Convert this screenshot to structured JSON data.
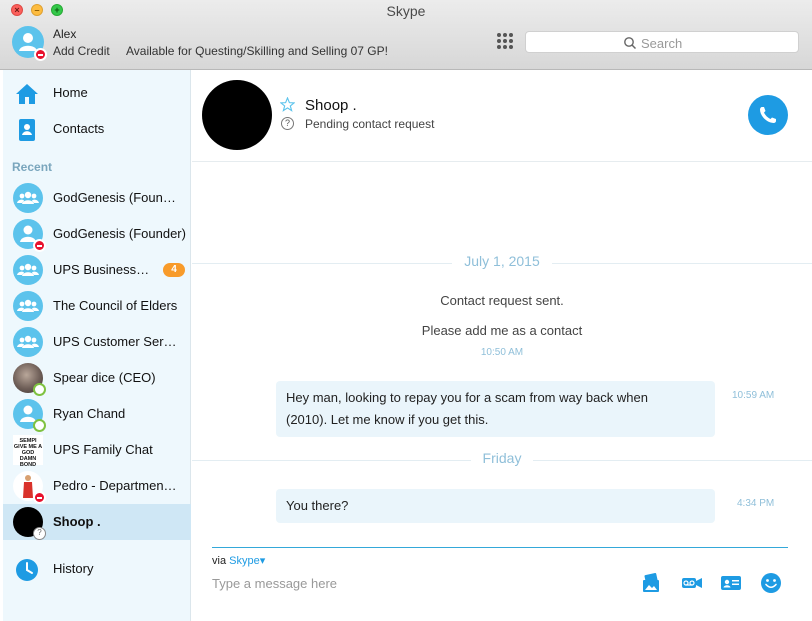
{
  "window": {
    "title": "Skype",
    "traffic": {
      "close": "×",
      "minimize": "–",
      "maximize": "+"
    }
  },
  "profile": {
    "name": "Alex",
    "credit_label": "Add Credit",
    "mood": "Available for Questing/Skilling and Selling 07 GP!"
  },
  "search": {
    "placeholder": "Search"
  },
  "sidebar": {
    "nav": [
      {
        "label": "Home",
        "icon": "home-icon"
      },
      {
        "label": "Contacts",
        "icon": "contacts-icon"
      }
    ],
    "recent_label": "Recent",
    "contacts": [
      {
        "name": "GodGenesis (Foun…",
        "avatar": "group"
      },
      {
        "name": "GodGenesis (Founder)",
        "avatar": "person",
        "status": "dnd"
      },
      {
        "name": "UPS Business…",
        "avatar": "group",
        "badge": "4"
      },
      {
        "name": "The Council of Elders",
        "avatar": "group"
      },
      {
        "name": "UPS Customer Ser…",
        "avatar": "group"
      },
      {
        "name": "Spear dice (CEO)",
        "avatar": "photo",
        "status": "online"
      },
      {
        "name": "Ryan Chand",
        "avatar": "person",
        "status": "online"
      },
      {
        "name": "UPS Family Chat",
        "avatar": "text",
        "avatar_text": "SEMPI GIVE ME A GOD DAMN BOND"
      },
      {
        "name": "Pedro - Departmen…",
        "avatar": "photo2",
        "status": "dnd"
      },
      {
        "name": "Shoop .",
        "avatar": "black",
        "status": "pending",
        "selected": true
      }
    ],
    "history_label": "History"
  },
  "conversation": {
    "name": "Shoop .",
    "status": "Pending contact request",
    "status_icon_text": "?",
    "separators": [
      "July 1, 2015",
      "Friday"
    ],
    "system_messages": [
      "Contact request sent.",
      "Please add me as a contact"
    ],
    "system_time": "10:50 AM",
    "messages": [
      {
        "text_line1": "Hey man, looking to repay you for a scam from way back when",
        "text_line2": "(2010). Let me know if you get this.",
        "time": "10:59 AM"
      },
      {
        "text": "You there?",
        "time": "4:34 PM"
      }
    ]
  },
  "composer": {
    "via_prefix": "via",
    "via_service": "Skype",
    "placeholder": "Type a message here"
  },
  "colors": {
    "accent": "#1e9be3",
    "avatar_blue": "#5cc3ec",
    "sidebar_bg": "#eef8fd",
    "selected_bg": "#cfe7f5",
    "badge": "#f89b2a",
    "dnd": "#e8112d",
    "online": "#7fc241"
  }
}
